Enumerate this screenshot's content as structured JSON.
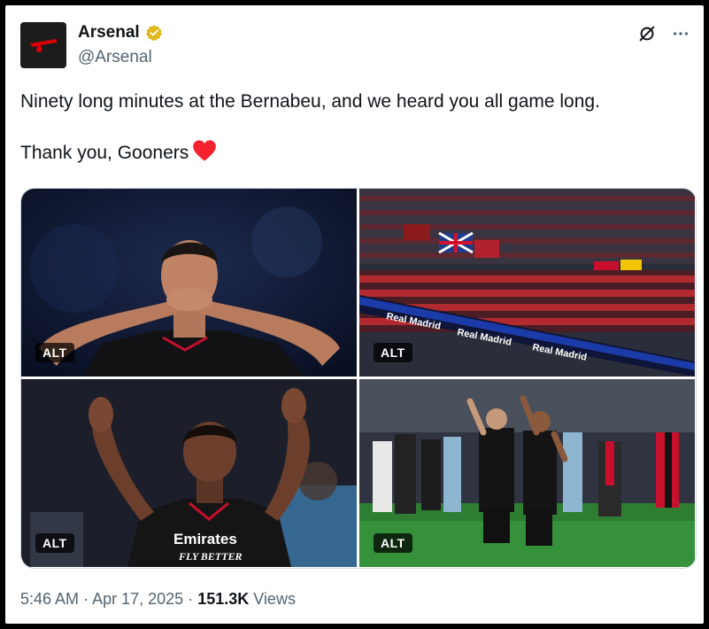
{
  "account": {
    "name": "Arsenal",
    "handle": "@Arsenal",
    "verified_color": "#e2b719"
  },
  "tweet": {
    "line1": "Ninety long minutes at the Bernabeu, and we heard you all game long.",
    "line2": "Thank you, Gooners"
  },
  "media": [
    {
      "alt_label": "ALT",
      "jersey_text": ""
    },
    {
      "alt_label": "ALT",
      "banner_1": "Real Madrid",
      "banner_2": "Real Madrid",
      "banner_3": "Real Madrid"
    },
    {
      "alt_label": "ALT",
      "jersey_text_1": "Emirates",
      "jersey_text_2": "FLY BETTER"
    },
    {
      "alt_label": "ALT"
    }
  ],
  "meta": {
    "time": "5:46 AM",
    "separator": "·",
    "date": "Apr 17, 2025",
    "views_count": "151.3K",
    "views_label": "Views"
  },
  "colors": {
    "text_primary": "#0f1419",
    "text_secondary": "#536471",
    "heart": "#f4212e",
    "arsenal_red": "#db0007"
  }
}
